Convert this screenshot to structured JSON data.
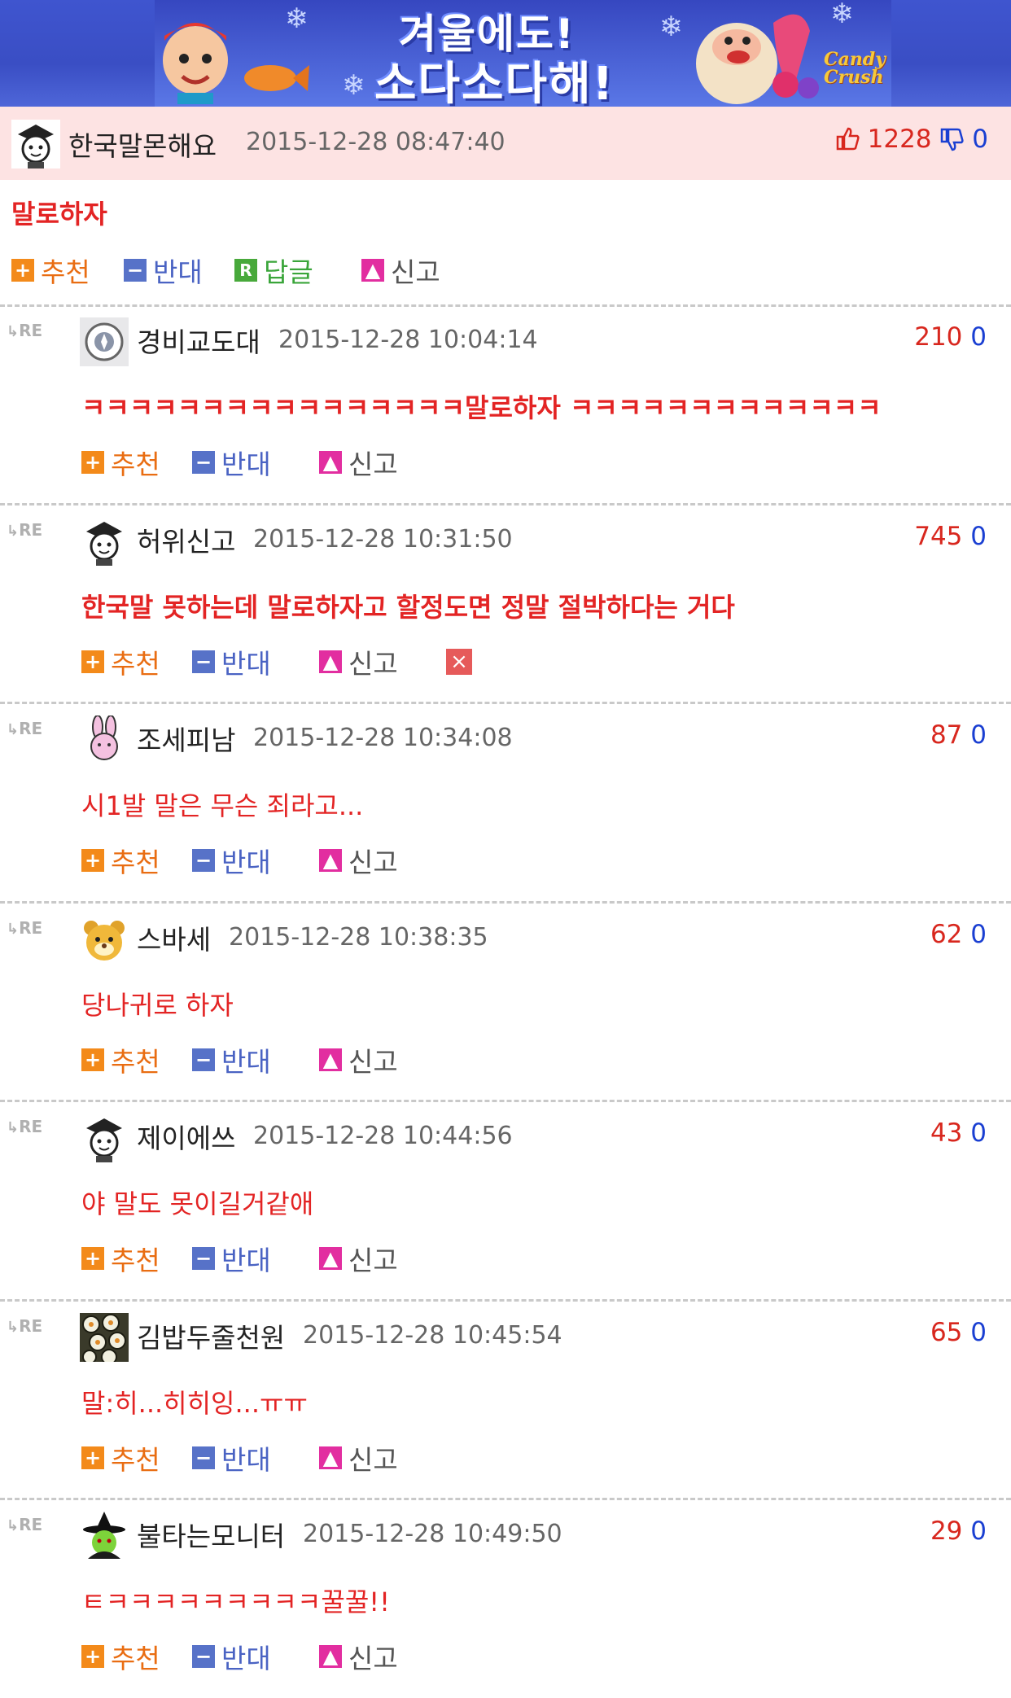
{
  "banner": {
    "line1": "겨울에도!",
    "line2": "소다소다해!",
    "brand": "Candy Crush"
  },
  "post": {
    "author": "한국말몬해요",
    "date": "2015-12-28 08:47:40",
    "upvotes": "1228",
    "downvotes": "0",
    "body": "말로하자",
    "actions": {
      "recommend": "추천",
      "oppose": "반대",
      "reply": "답글",
      "report": "신고"
    }
  },
  "comments": [
    {
      "author": "경비교도대",
      "date": "2015-12-28 10:04:14",
      "up": "210",
      "down": "0",
      "text": "ㅋㅋㅋㅋㅋㅋㅋㅋㅋㅋㅋㅋㅋㅋㅋㅋ말로하자 ㅋㅋㅋㅋㅋㅋㅋㅋㅋㅋㅋㅋㅋ",
      "bold": true,
      "avatar": "badge"
    },
    {
      "author": "허위신고",
      "date": "2015-12-28 10:31:50",
      "up": "745",
      "down": "0",
      "text": "한국말 못하는데 말로하자고 할정도면 정말 절박하다는 거다",
      "bold": true,
      "avatar": "grad",
      "close": true
    },
    {
      "author": "조세피남",
      "date": "2015-12-28 10:34:08",
      "up": "87",
      "down": "0",
      "text": "시1발 말은 무슨 죄라고...",
      "bold": false,
      "avatar": "bunny"
    },
    {
      "author": "스바세",
      "date": "2015-12-28 10:38:35",
      "up": "62",
      "down": "0",
      "text": "당나귀로 하자",
      "bold": false,
      "avatar": "bear"
    },
    {
      "author": "제이에쓰",
      "date": "2015-12-28 10:44:56",
      "up": "43",
      "down": "0",
      "text": "야 말도 못이길거같애",
      "bold": false,
      "avatar": "grad"
    },
    {
      "author": "김밥두줄천원",
      "date": "2015-12-28 10:45:54",
      "up": "65",
      "down": "0",
      "text": "말:히...히히잉...ㅠㅠ",
      "bold": false,
      "avatar": "kimbap"
    },
    {
      "author": "불타는모니터",
      "date": "2015-12-28 10:49:50",
      "up": "29",
      "down": "0",
      "text": "ㅌㅋㅋㅋㅋㅋㅋㅋㅋㅋ꿀꿀!!",
      "bold": false,
      "avatar": "witch"
    }
  ],
  "comment_actions": {
    "recommend": "추천",
    "oppose": "반대",
    "report": "신고"
  },
  "re_label": "RE",
  "icons": {
    "up": "thumbs-up-icon",
    "down": "thumbs-down-icon"
  },
  "colors": {
    "header_bg": "#fde3e3",
    "text_red": "#e32424",
    "up": "#d8271e",
    "down": "#1a3fd2"
  }
}
